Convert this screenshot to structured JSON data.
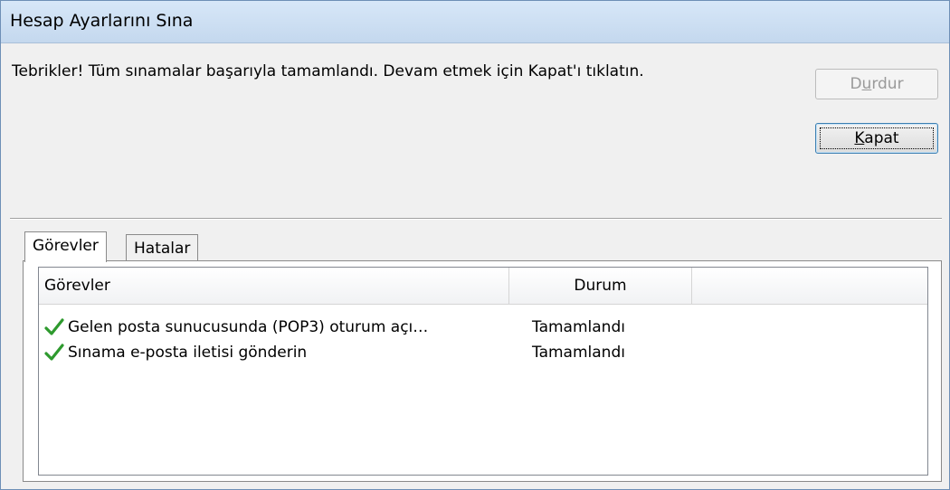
{
  "window": {
    "title": "Hesap Ayarlarını Sına"
  },
  "message": "Tebrikler! Tüm sınamalar başarıyla tamamlandı. Devam etmek için Kapat'ı tıklatın.",
  "buttons": {
    "stop": {
      "pre": "D",
      "accel": "u",
      "post": "rdur",
      "enabled": false
    },
    "close": {
      "pre": "",
      "accel": "K",
      "post": "apat",
      "default": true
    }
  },
  "tabs": [
    {
      "label": "Görevler",
      "active": true
    },
    {
      "label": "Hatalar",
      "active": false
    }
  ],
  "table": {
    "columns": [
      "Görevler",
      "Durum"
    ],
    "rows": [
      {
        "task": "Gelen posta sunucusunda (POP3) oturum açı…",
        "status": "Tamamlandı",
        "icon": "checkmark-icon"
      },
      {
        "task": "Sınama e-posta iletisi gönderin",
        "status": "Tamamlandı",
        "icon": "checkmark-icon"
      }
    ]
  },
  "colors": {
    "titlebar": "#c9dcf0",
    "check_green": "#2e9a2e",
    "default_button_border": "#3c7fb1"
  }
}
